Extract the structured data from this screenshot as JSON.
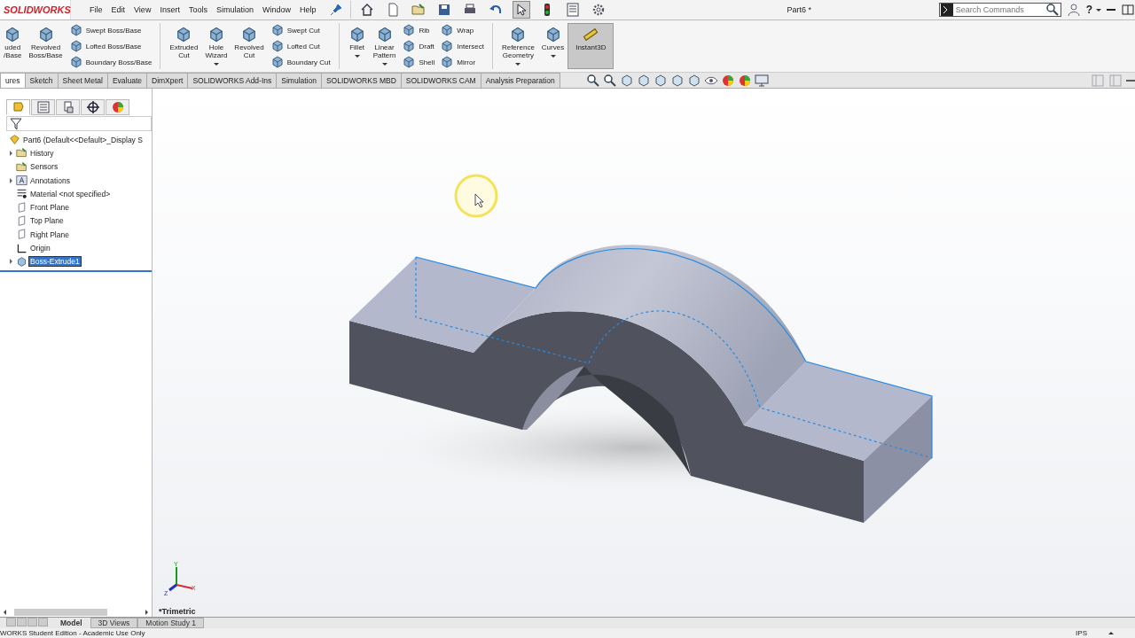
{
  "app": {
    "logo": "SOLIDWORKS"
  },
  "menu": [
    "File",
    "Edit",
    "View",
    "Insert",
    "Tools",
    "Simulation",
    "Window",
    "Help"
  ],
  "quick_tools": [
    {
      "kind": "home",
      "selected": false
    },
    {
      "kind": "page",
      "selected": false
    },
    {
      "kind": "folder",
      "selected": false
    },
    {
      "kind": "save",
      "selected": false
    },
    {
      "kind": "print",
      "selected": false
    },
    {
      "kind": "undo",
      "selected": false
    },
    {
      "kind": "pointer",
      "selected": true
    },
    {
      "kind": "light",
      "selected": false
    },
    {
      "kind": "list",
      "selected": false
    },
    {
      "kind": "gear",
      "selected": false
    }
  ],
  "document_title": "Part6 *",
  "search": {
    "placeholder": "Search Commands"
  },
  "help": "?",
  "ribbon": [
    {
      "kind": "large",
      "lines": [
        "uded",
        "/Base"
      ],
      "dropdown": false,
      "selected": false
    },
    {
      "kind": "large",
      "lines": [
        "Revolved",
        "Boss/Base"
      ],
      "dropdown": false,
      "selected": false
    },
    {
      "kind": "stack",
      "items": [
        "Swept Boss/Base",
        "Lofted Boss/Base",
        "Boundary Boss/Base"
      ]
    },
    {
      "kind": "separator"
    },
    {
      "kind": "large",
      "lines": [
        "Extruded",
        "Cut"
      ],
      "dropdown": false,
      "selected": false
    },
    {
      "kind": "large",
      "lines": [
        "Hole",
        "Wizard"
      ],
      "dropdown": true,
      "selected": false
    },
    {
      "kind": "large",
      "lines": [
        "Revolved",
        "Cut"
      ],
      "dropdown": false,
      "selected": false
    },
    {
      "kind": "stack",
      "items": [
        "Swept Cut",
        "Lofted Cut",
        "Boundary Cut"
      ]
    },
    {
      "kind": "separator"
    },
    {
      "kind": "large",
      "lines": [
        "Fillet"
      ],
      "dropdown": true,
      "selected": false
    },
    {
      "kind": "large",
      "lines": [
        "Linear",
        "Pattern"
      ],
      "dropdown": true,
      "selected": false
    },
    {
      "kind": "stack",
      "items": [
        "Rib",
        "Draft",
        "Shell"
      ]
    },
    {
      "kind": "stack",
      "items": [
        "Wrap",
        "Intersect",
        "Mirror"
      ]
    },
    {
      "kind": "separator"
    },
    {
      "kind": "large",
      "lines": [
        "Reference",
        "Geometry"
      ],
      "dropdown": true,
      "selected": false
    },
    {
      "kind": "large",
      "lines": [
        "Curves"
      ],
      "dropdown": true,
      "selected": false
    },
    {
      "kind": "large",
      "lines": [
        "Instant3D"
      ],
      "dropdown": false,
      "selected": true
    }
  ],
  "tabs": [
    {
      "label": "ures",
      "selected": true
    },
    {
      "label": "Sketch",
      "selected": false
    },
    {
      "label": "Sheet Metal",
      "selected": false
    },
    {
      "label": "Evaluate",
      "selected": false
    },
    {
      "label": "DimXpert",
      "selected": false
    },
    {
      "label": "SOLIDWORKS Add-Ins",
      "selected": false
    },
    {
      "label": "Simulation",
      "selected": false
    },
    {
      "label": "SOLIDWORKS MBD",
      "selected": false
    },
    {
      "label": "SOLIDWORKS CAM",
      "selected": false
    },
    {
      "label": "Analysis Preparation",
      "selected": false
    }
  ],
  "feature_manager": {
    "panel_tabs": [
      {
        "kind": "tree",
        "selected": true
      },
      {
        "kind": "properties",
        "selected": false
      },
      {
        "kind": "config",
        "selected": false
      },
      {
        "kind": "target",
        "selected": false
      },
      {
        "kind": "appearance",
        "selected": false
      }
    ],
    "tree": [
      {
        "label": "Part6  (Default<<Default>_Display S",
        "kind": "part",
        "has_children": false,
        "selected": false,
        "children": [
          {
            "label": "History",
            "kind": "folder",
            "has_children": true,
            "selected": false
          },
          {
            "label": "Sensors",
            "kind": "folder",
            "has_children": false,
            "selected": false
          },
          {
            "label": "Annotations",
            "kind": "annotation",
            "has_children": true,
            "selected": false
          },
          {
            "label": "Material <not specified>",
            "kind": "material",
            "has_children": false,
            "selected": false
          },
          {
            "label": "Front Plane",
            "kind": "plane",
            "has_children": false,
            "selected": false
          },
          {
            "label": "Top Plane",
            "kind": "plane",
            "has_children": false,
            "selected": false
          },
          {
            "label": "Right Plane",
            "kind": "plane",
            "has_children": false,
            "selected": false
          },
          {
            "label": "Origin",
            "kind": "origin",
            "has_children": false,
            "selected": false
          },
          {
            "label": "Boss-Extrude1",
            "kind": "feature",
            "has_children": true,
            "selected": true
          }
        ]
      }
    ]
  },
  "viewport": {
    "view_label": "*Trimetric",
    "triad": {
      "x": "X",
      "y": "Y",
      "z": "Z"
    }
  },
  "bottom_tabs": [
    {
      "label": "Model",
      "selected": true
    },
    {
      "label": "3D Views",
      "selected": false
    },
    {
      "label": "Motion Study 1",
      "selected": false
    }
  ],
  "status_bar": {
    "text": "WORKS Student Edition - Academic Use Only",
    "units": "IPS"
  }
}
